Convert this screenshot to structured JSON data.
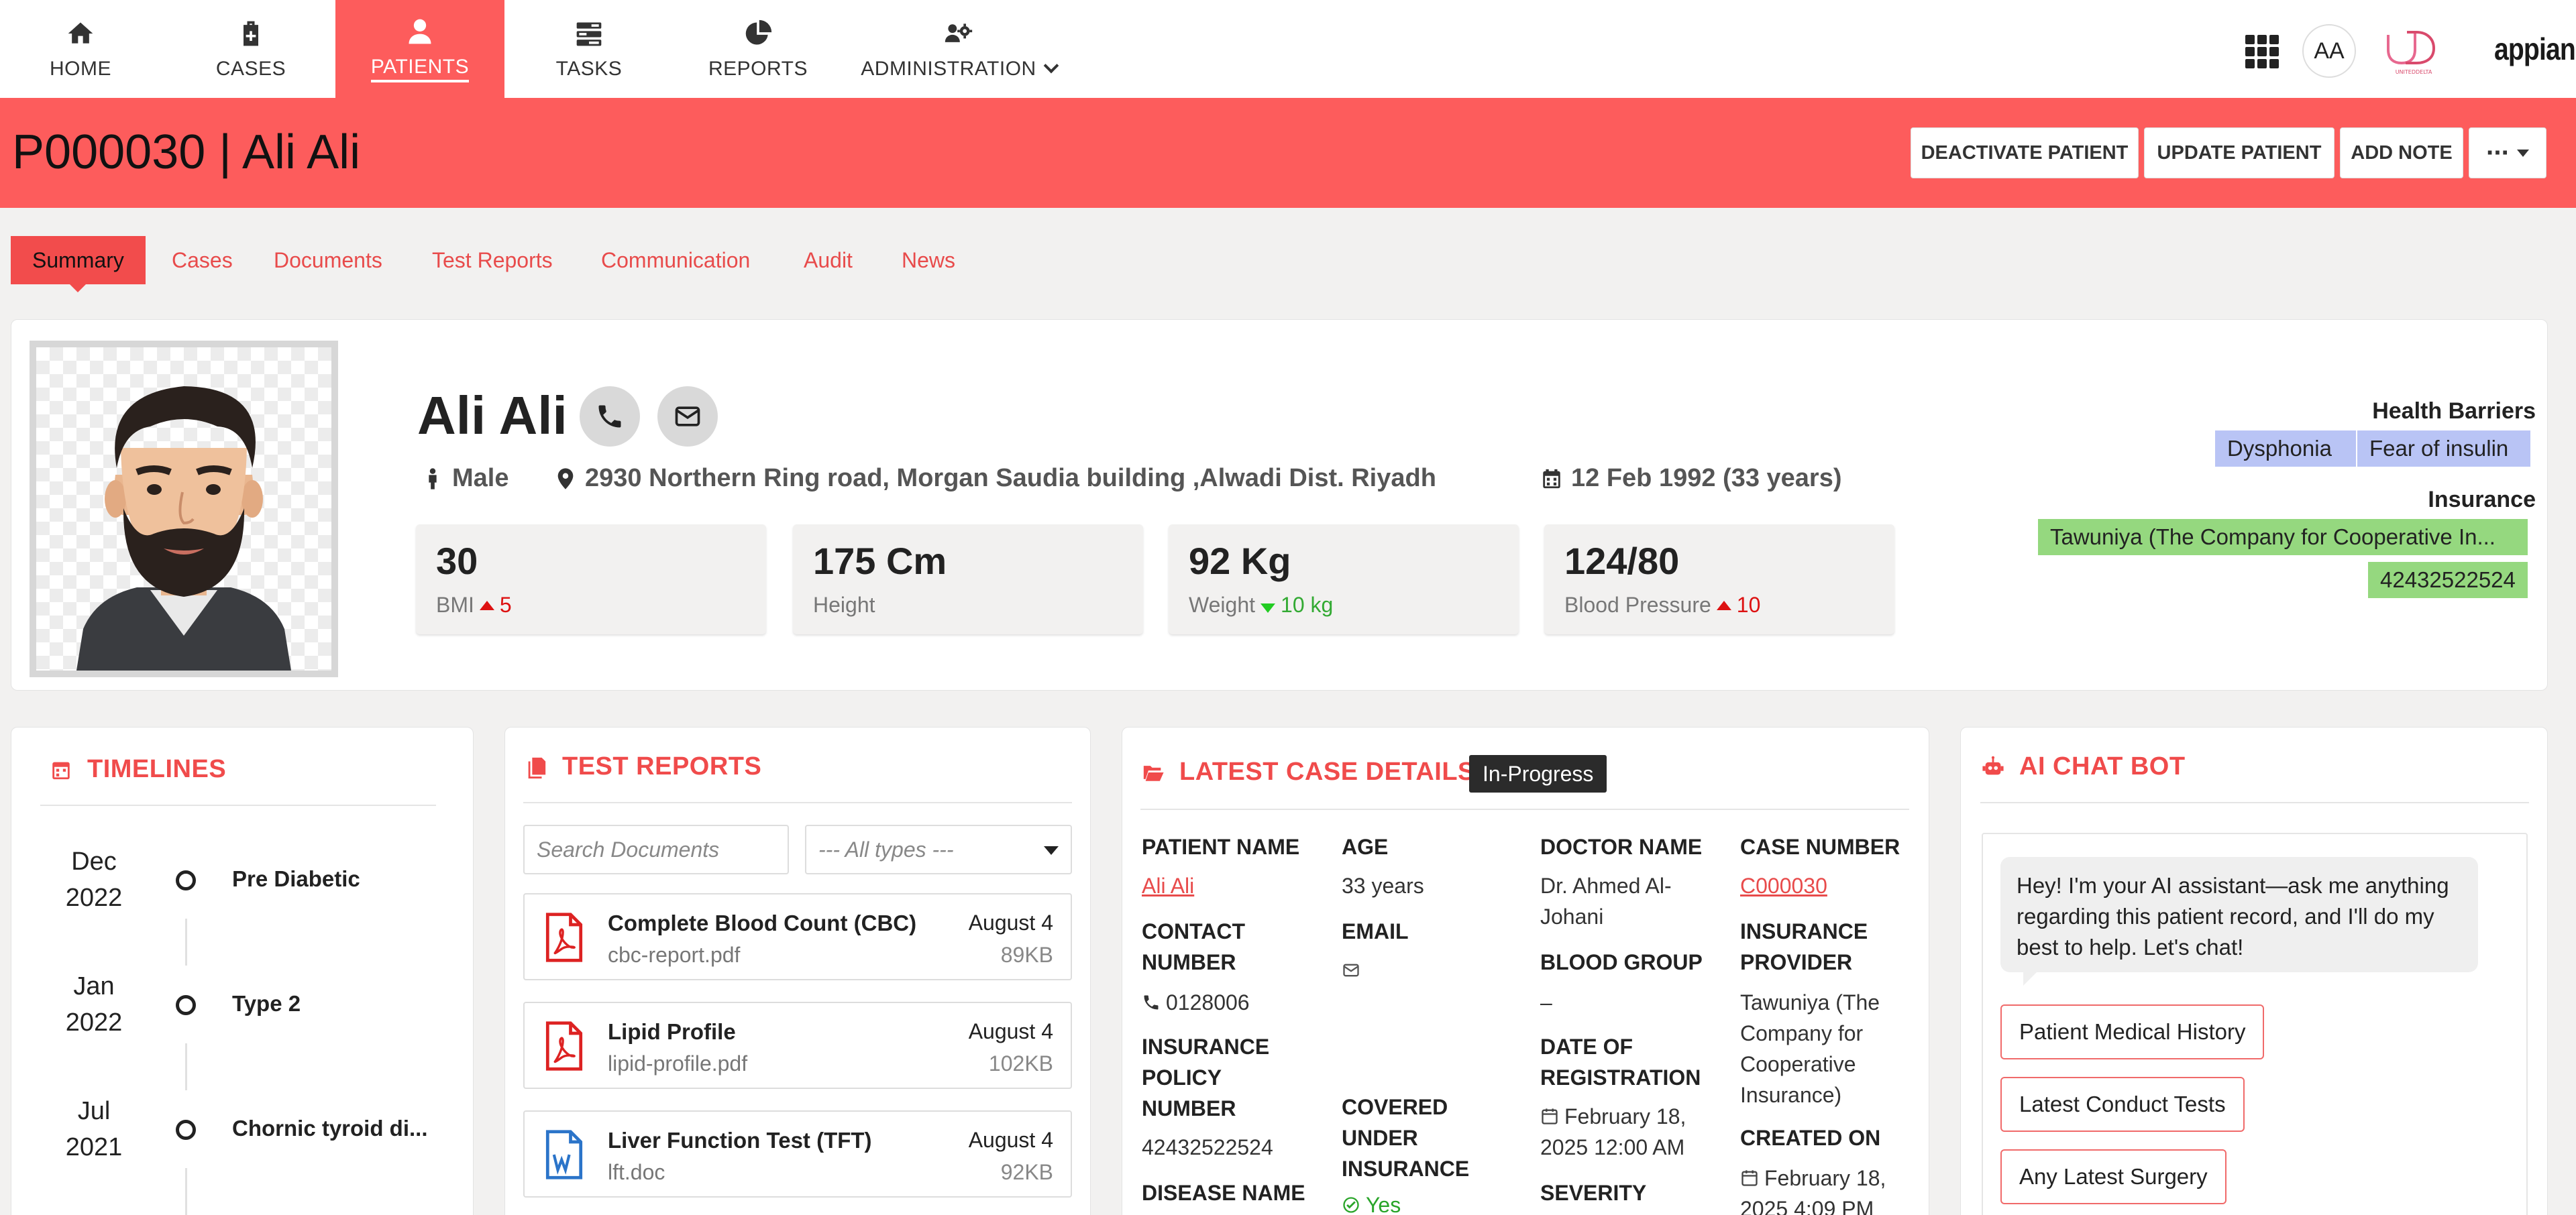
{
  "nav": {
    "tabs": [
      {
        "label": "HOME",
        "icon": "home-icon"
      },
      {
        "label": "CASES",
        "icon": "medical-briefcase-icon"
      },
      {
        "label": "PATIENTS",
        "icon": "user-icon",
        "active": true
      },
      {
        "label": "TASKS",
        "icon": "tasks-icon"
      },
      {
        "label": "REPORTS",
        "icon": "pie-chart-icon"
      },
      {
        "label": "ADMINISTRATION",
        "icon": "users-gear-icon"
      }
    ],
    "user_initials": "AA",
    "org_logo_text": "UNITEDDELTA",
    "appian_logo": "appian",
    "accent_color": "#fd5c5c"
  },
  "header": {
    "title": "P000030 | Ali Ali",
    "buttons": {
      "deactivate": "DEACTIVATE PATIENT",
      "update": "UPDATE PATIENT",
      "add_note": "ADD NOTE",
      "more": "···"
    }
  },
  "subtabs": [
    "Summary",
    "Cases",
    "Documents",
    "Test Reports",
    "Communication",
    "Audit",
    "News"
  ],
  "patient": {
    "name": "Ali Ali",
    "gender": "Male",
    "address": "2930 Northern Ring road, Morgan Saudia building ,Alwadi Dist. Riyadh",
    "dob": "12 Feb 1992 (33 years)",
    "stats": [
      {
        "value": "30",
        "label": "BMI",
        "trend": "up",
        "delta": "5"
      },
      {
        "value": "175 Cm",
        "label": "Height"
      },
      {
        "value": "92 Kg",
        "label": "Weight",
        "trend": "down",
        "delta": "10 kg"
      },
      {
        "value": "124/80",
        "label": "Blood Pressure",
        "trend": "up",
        "delta": "10"
      }
    ],
    "health_barriers_label": "Health Barriers",
    "health_barriers": [
      "Dysphonia",
      "Fear of insulin"
    ],
    "insurance_label": "Insurance",
    "insurance": [
      "Tawuniya (The Company for Cooperative In...",
      "42432522524"
    ]
  },
  "timelines": {
    "title": "TIMELINES",
    "items": [
      {
        "month": "Dec",
        "year": "2022",
        "text": "Pre Diabetic"
      },
      {
        "month": "Jan",
        "year": "2022",
        "text": "Type 2"
      },
      {
        "month": "Jul",
        "year": "2021",
        "text": "Chornic tyroid di..."
      }
    ]
  },
  "test_reports": {
    "title": "TEST REPORTS",
    "search_placeholder": "Search Documents",
    "type_filter": "--- All types ---",
    "items": [
      {
        "title": "Complete Blood Count (CBC)",
        "file": "cbc-report.pdf",
        "date": "August 4",
        "size": "89KB",
        "type": "pdf"
      },
      {
        "title": "Lipid Profile",
        "file": "lipid-profile.pdf",
        "date": "August 4",
        "size": "102KB",
        "type": "pdf"
      },
      {
        "title": "Liver Function Test (TFT)",
        "file": "lft.doc",
        "date": "August 4",
        "size": "92KB",
        "type": "doc"
      }
    ]
  },
  "case_details": {
    "title": "LATEST CASE DETAILS",
    "status": "In-Progress",
    "labels": {
      "patient_name": "PATIENT NAME",
      "age": "AGE",
      "doctor_name": "DOCTOR NAME",
      "case_number": "CASE NUMBER",
      "contact_1": "CONTACT",
      "contact_2": "NUMBER",
      "email": "EMAIL",
      "blood_group": "BLOOD GROUP",
      "insurance_provider_1": "INSURANCE",
      "insurance_provider_2": "PROVIDER",
      "policy_1": "INSURANCE",
      "policy_2": "POLICY",
      "policy_3": "NUMBER",
      "date_reg_1": "DATE OF",
      "date_reg_2": "REGISTRATION",
      "covered_1": "COVERED",
      "covered_2": "UNDER",
      "covered_3": "INSURANCE",
      "created_on": "CREATED ON",
      "disease_name": "DISEASE NAME",
      "severity": "SEVERITY"
    },
    "values": {
      "patient_name": "Ali Ali",
      "age": "33 years",
      "doctor_name_1": "Dr. Ahmed Al-",
      "doctor_name_2": "Johani",
      "case_number": "C000030",
      "contact_number": "0128006",
      "blood_group": "–",
      "insurance_provider_1": "Tawuniya (The",
      "insurance_provider_2": "Company for",
      "insurance_provider_3": "Cooperative",
      "insurance_provider_4": "Insurance)",
      "policy_number": "42432522524",
      "date_reg_1": "February 18,",
      "date_reg_2": "2025 12:00 AM",
      "covered": "Yes",
      "created_on_1": "February 18,",
      "created_on_2": "2025 4:09 PM"
    }
  },
  "chat": {
    "title": "AI CHAT BOT",
    "bubble_1": "Hey! I'm your AI assistant—ask me anything",
    "bubble_2": "regarding this patient record, and I'll do my",
    "bubble_3": "best to help. Let's chat!",
    "chips": [
      "Patient Medical History",
      "Latest Conduct Tests",
      "Any Latest Surgery"
    ]
  }
}
